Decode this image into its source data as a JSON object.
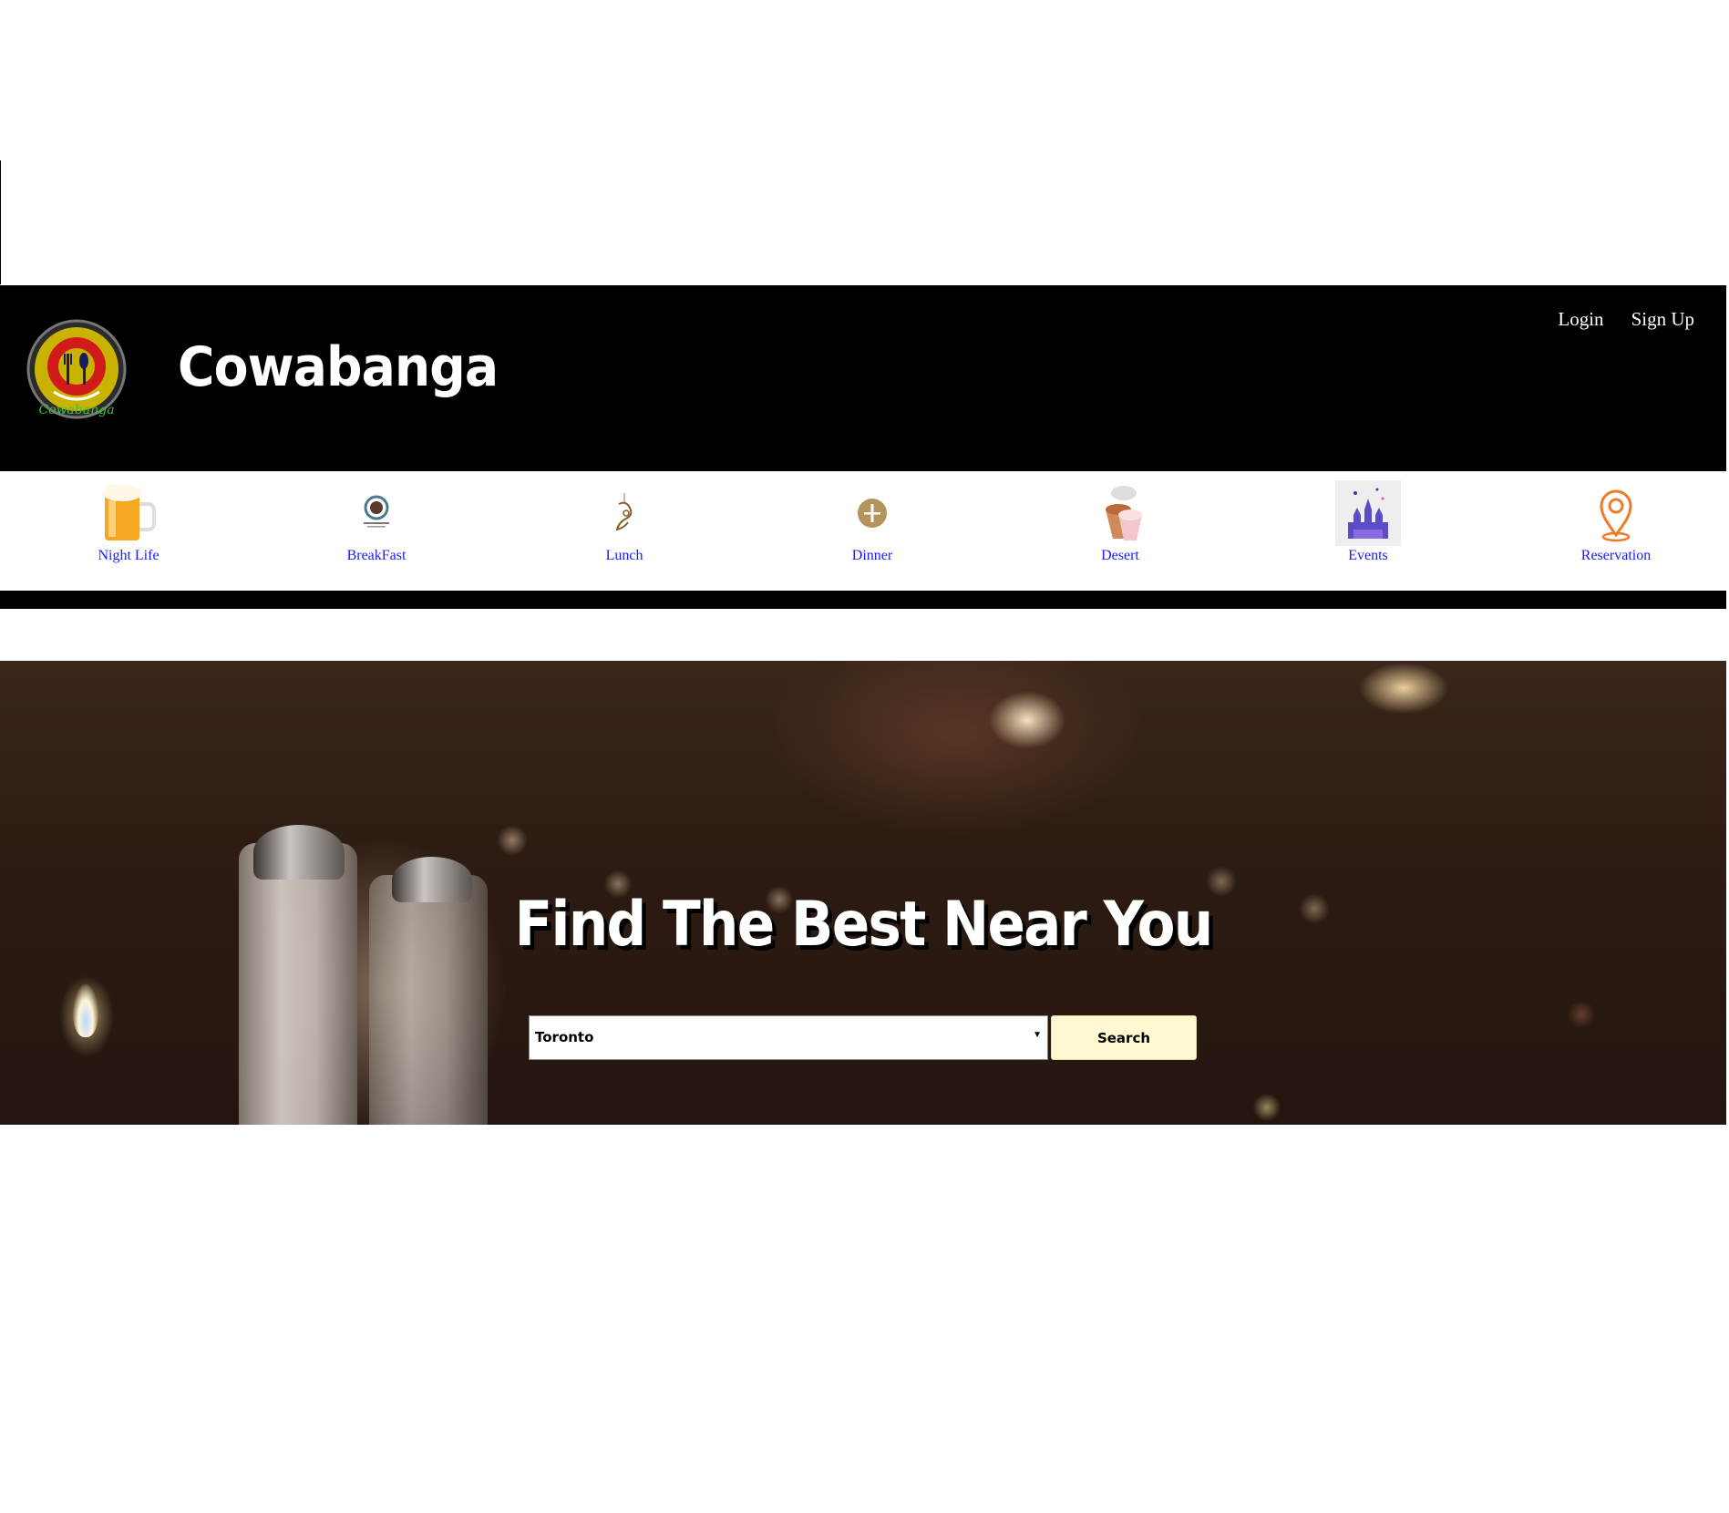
{
  "header": {
    "brand": "Cowabanga",
    "logo_text": "Cowabanga",
    "login_label": "Login",
    "signup_label": "Sign Up"
  },
  "categories": [
    {
      "label": "Night Life",
      "icon": "beer-mug-icon"
    },
    {
      "label": "BreakFast",
      "icon": "coffee-cup-icon"
    },
    {
      "label": "Lunch",
      "icon": "lunch-icon"
    },
    {
      "label": "Dinner",
      "icon": "plate-icon"
    },
    {
      "label": "Desert",
      "icon": "ice-cream-cups-icon"
    },
    {
      "label": "Events",
      "icon": "castle-icon"
    },
    {
      "label": "Reservation",
      "icon": "location-pin-icon"
    }
  ],
  "hero": {
    "title": "Find The Best Near You",
    "city_select": {
      "selected": "Toronto"
    },
    "search_label": "Search"
  },
  "colors": {
    "header_bg": "#000000",
    "category_link": "#1a1aff",
    "search_button": "#fff8d0"
  }
}
